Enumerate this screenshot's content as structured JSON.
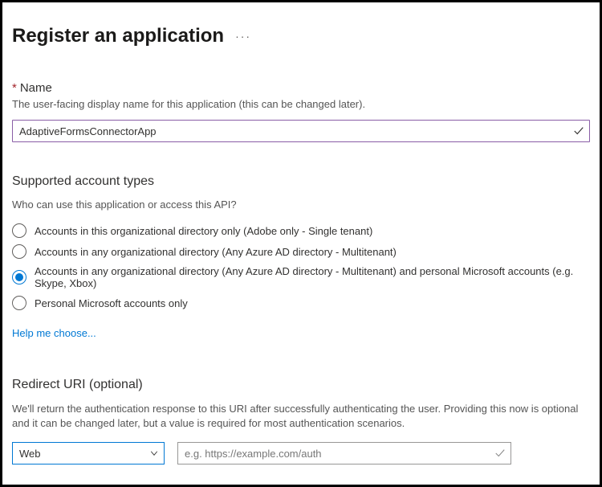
{
  "page": {
    "title": "Register an application"
  },
  "name": {
    "label": "Name",
    "required": "*",
    "help": "The user-facing display name for this application (this can be changed later).",
    "value": "AdaptiveFormsConnectorApp"
  },
  "accountTypes": {
    "label": "Supported account types",
    "help": "Who can use this application or access this API?",
    "options": [
      "Accounts in this organizational directory only (Adobe only - Single tenant)",
      "Accounts in any organizational directory (Any Azure AD directory - Multitenant)",
      "Accounts in any organizational directory (Any Azure AD directory - Multitenant) and personal Microsoft accounts (e.g. Skype, Xbox)",
      "Personal Microsoft accounts only"
    ],
    "helpLink": "Help me choose..."
  },
  "redirect": {
    "label": "Redirect URI (optional)",
    "help": "We'll return the authentication response to this URI after successfully authenticating the user. Providing this now is optional and it can be changed later, but a value is required for most authentication scenarios.",
    "platformValue": "Web",
    "uriPlaceholder": "e.g. https://example.com/auth"
  }
}
